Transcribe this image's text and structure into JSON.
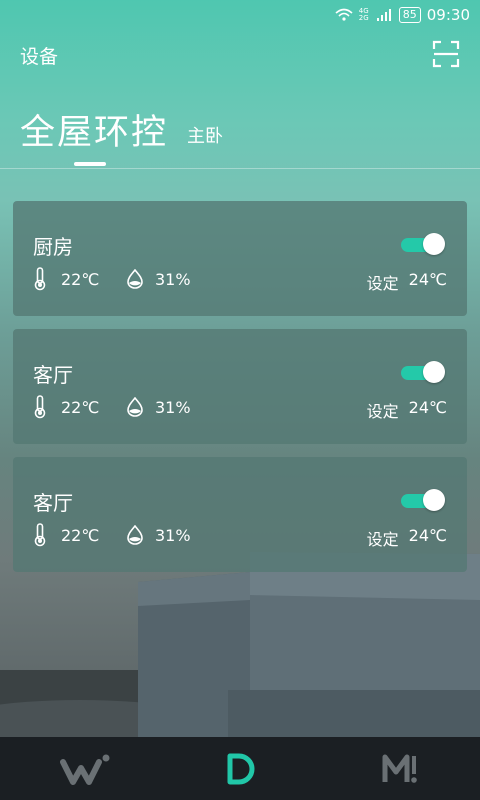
{
  "status_bar": {
    "network_label": "4G 2G",
    "battery": "85",
    "time": "09:30"
  },
  "header": {
    "title": "设备",
    "scan_icon": "scan-icon"
  },
  "page": {
    "title": "全屋环控",
    "subtitle": "主卧"
  },
  "rooms": [
    {
      "name": "厨房",
      "temp": "22℃",
      "humidity": "31%",
      "set_label": "设定",
      "set_temp": "24℃",
      "on": true
    },
    {
      "name": "客厅",
      "temp": "22℃",
      "humidity": "31%",
      "set_label": "设定",
      "set_temp": "24℃",
      "on": true
    },
    {
      "name": "客厅",
      "temp": "22℃",
      "humidity": "31%",
      "set_label": "设定",
      "set_temp": "24℃",
      "on": true
    }
  ],
  "nav": {
    "items": [
      "W",
      "D",
      "M"
    ],
    "active": "D",
    "accent": "#21c7a8",
    "inactive": "#6a7074"
  }
}
